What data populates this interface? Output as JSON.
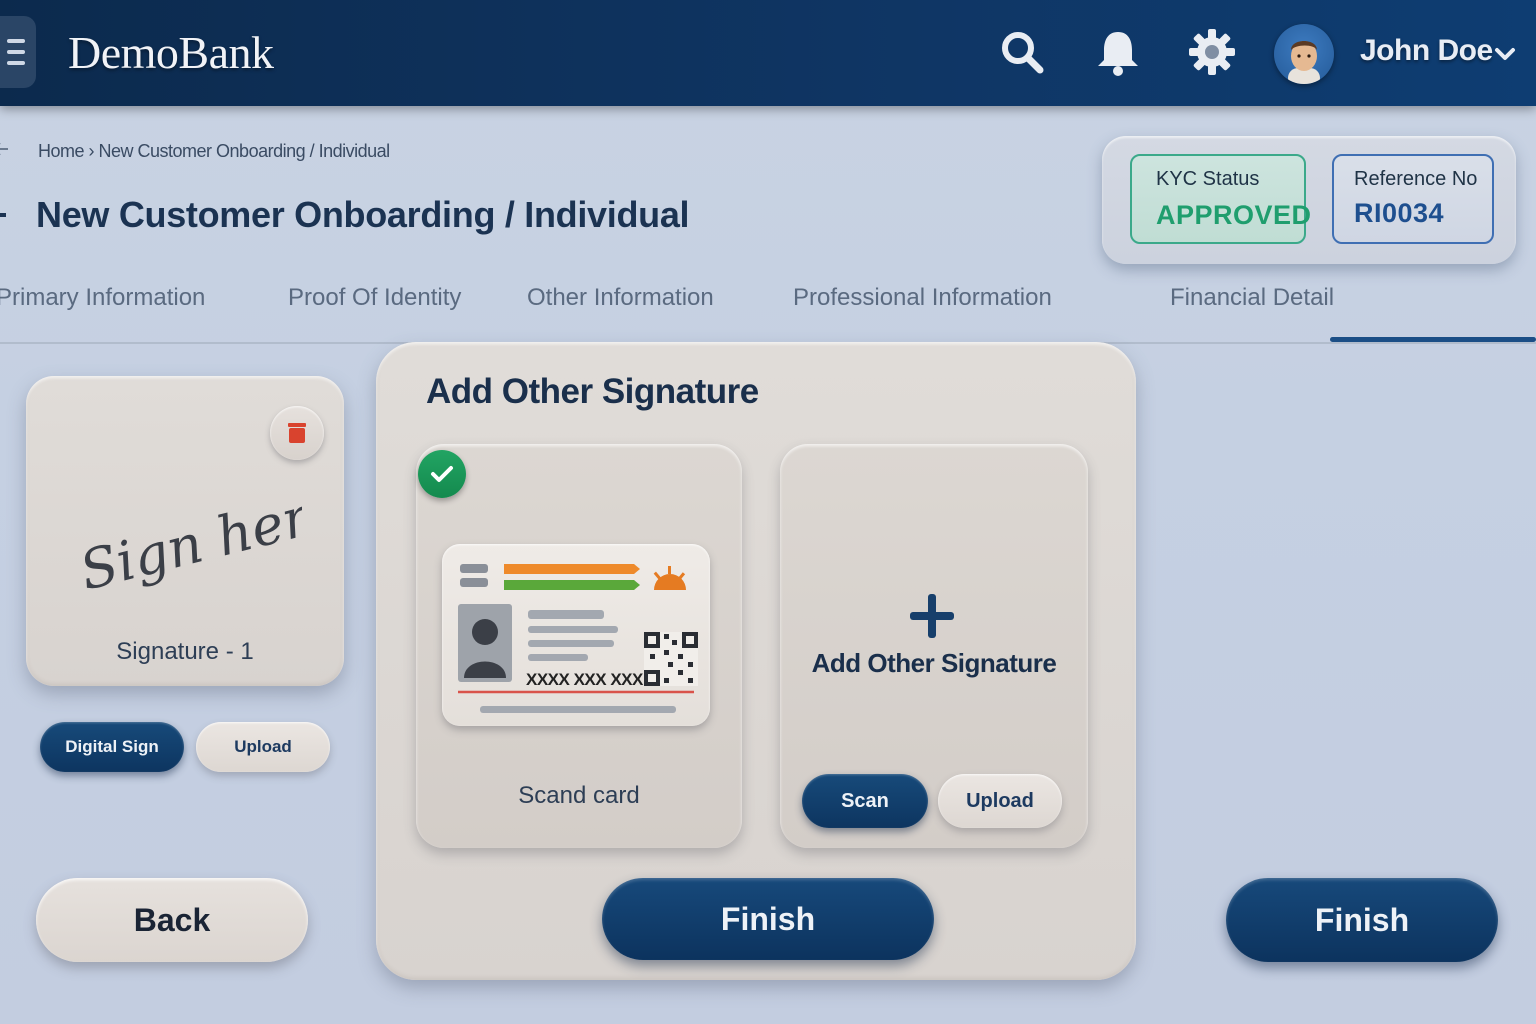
{
  "header": {
    "brand": "DemoBank",
    "user_name": "John Doe",
    "icons": [
      "menu-icon",
      "search-icon",
      "bell-icon",
      "gear-icon",
      "avatar",
      "chevron-down-icon"
    ]
  },
  "page": {
    "breadcrumb": "Home › New Customer Onboarding / Individual",
    "title": "New Customer Onboarding / Individual"
  },
  "status": {
    "kyc_label": "KYC Status",
    "kyc_value": "APPROVED",
    "ref_label": "Reference No",
    "ref_value": "RI0034"
  },
  "tabs": [
    {
      "label": "Primary Information"
    },
    {
      "label": "Proof Of Identity"
    },
    {
      "label": "Other Information"
    },
    {
      "label": "Professional Information"
    },
    {
      "label": "Financial Detail",
      "active": true
    }
  ],
  "signature_card": {
    "placeholder_text": "Sign here",
    "label": "Signature - 1",
    "digital_sign_label": "Digital Sign",
    "upload_label": "Upload"
  },
  "main_panel": {
    "title": "Add Other Signature",
    "scan_card": {
      "id_number": "XXXX XXX  XXX",
      "label": "Scand card"
    },
    "add_card": {
      "label": "Add Other Signature",
      "scan_label": "Scan",
      "upload_label": "Upload"
    },
    "finish_label": "Finish"
  },
  "footer": {
    "back_label": "Back",
    "finish_label": "Finish"
  },
  "colors": {
    "primary": "#0f3563",
    "approved": "#1f9e6e",
    "reference": "#1e4f8f",
    "delete": "#d9432e"
  }
}
